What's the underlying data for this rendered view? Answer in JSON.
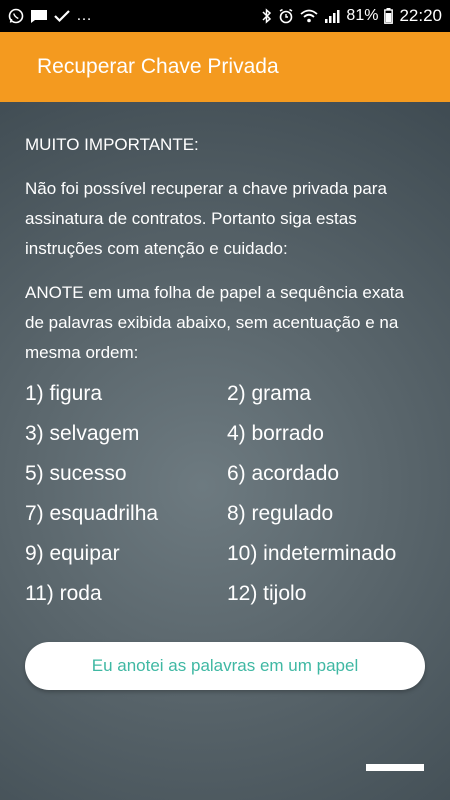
{
  "status_bar": {
    "left_icons": [
      "whatsapp-icon",
      "message-icon",
      "check-icon"
    ],
    "overflow": "…",
    "battery": "81%",
    "time": "22:20"
  },
  "app_bar": {
    "title": "Recuperar Chave Privada",
    "color": "#f49a1f"
  },
  "content": {
    "heading": "MUITO IMPORTANTE:",
    "paragraph1": "Não foi possível recuperar a chave privada para assinatura de contratos. Portanto siga estas instruções com atenção e cuidado:",
    "paragraph2": "ANOTE em uma folha de papel a sequência exata de palavras exibida abaixo, sem acentuação e na mesma ordem:",
    "words": [
      "1) figura",
      "2) grama",
      "3) selvagem",
      "4) borrado",
      "5) sucesso",
      "6) acordado",
      "7) esquadrilha",
      "8) regulado",
      "9) equipar",
      "10) indeterminado",
      "11) roda",
      "12) tijolo"
    ]
  },
  "button": {
    "label": "Eu anotei as palavras em um papel",
    "text_color": "#3fb8a3"
  }
}
